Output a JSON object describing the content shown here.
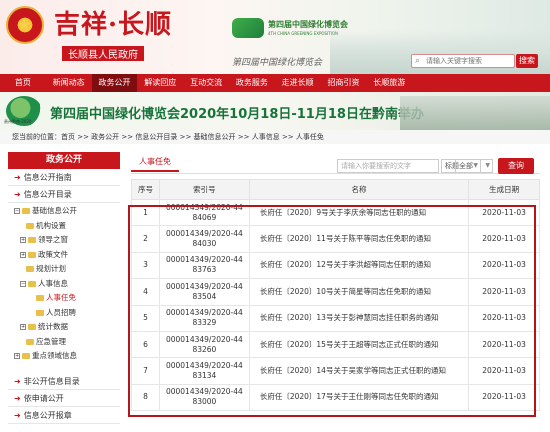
{
  "header": {
    "site_title": "吉祥·长顺",
    "site_subtitle": "长顺县人民政府",
    "expo_title": "第四届中国绿化博览会",
    "expo_subtitle": "4TH CHINA GREENING EXPOSITION",
    "script_text": "第四届中国绿化博览会",
    "search_placeholder": "请输入关键字搜索",
    "search_button": "搜索"
  },
  "nav": [
    "首页",
    "新闻动态",
    "政务公开",
    "解读回应",
    "互动交流",
    "政务服务",
    "走进长顺",
    "招商引资",
    "长顺旅游"
  ],
  "nav_active": 2,
  "banner": {
    "text": "第四届中国绿化博览会2020年10月18日-11月18日在黔南举办",
    "logo_text": "贵州黔南·2020"
  },
  "breadcrumb": "您当前的位置：首页 >> 政务公开 >> 信息公开目录 >> 基础信息公开 >> 人事信息 >> 人事任免",
  "sidebar": {
    "heading": "政务公开",
    "top_items": [
      "信息公开指南",
      "信息公开目录"
    ],
    "tree": [
      {
        "label": "基础信息公开",
        "level": 0,
        "box": "-"
      },
      {
        "label": "机构设置",
        "level": 1,
        "box": ""
      },
      {
        "label": "领导之窗",
        "level": 1,
        "box": "+"
      },
      {
        "label": "政策文件",
        "level": 1,
        "box": "+"
      },
      {
        "label": "规划计划",
        "level": 1,
        "box": ""
      },
      {
        "label": "人事信息",
        "level": 1,
        "box": "-"
      },
      {
        "label": "人事任免",
        "level": 2,
        "box": ""
      },
      {
        "label": "人员招聘",
        "level": 2,
        "box": ""
      },
      {
        "label": "统计数据",
        "level": 1,
        "box": "+"
      },
      {
        "label": "应急管理",
        "level": 1,
        "box": ""
      },
      {
        "label": "重点领域信息",
        "level": 0,
        "box": "+"
      }
    ],
    "bottom_items": [
      "非公开信息目录",
      "依申请公开",
      "信息公开报章"
    ]
  },
  "main": {
    "tab": "人事任免",
    "filter_placeholder": "请输入你要搜索的文字",
    "filter_field": "标题",
    "filter_scope": "全部",
    "query_button": "查询",
    "columns": [
      "序号",
      "索引号",
      "名称",
      "生成日期"
    ],
    "rows": [
      {
        "no": "1",
        "index": "000014349/2020-44 84069",
        "title": "长府任〔2020〕9号关于李庆余等同志任职的通知",
        "date": "2020-11-03"
      },
      {
        "no": "2",
        "index": "000014349/2020-44 84030",
        "title": "长府任〔2020〕11号关于陈平等同志任免职的通知",
        "date": "2020-11-03"
      },
      {
        "no": "3",
        "index": "000014349/2020-44 83763",
        "title": "长府任〔2020〕12号关于李洪超等同志任职的通知",
        "date": "2020-11-03"
      },
      {
        "no": "4",
        "index": "000014349/2020-44 83504",
        "title": "长府任〔2020〕10号关于简星等同志任免职的通知",
        "date": "2020-11-03"
      },
      {
        "no": "5",
        "index": "000014349/2020-44 83329",
        "title": "长府任〔2020〕13号关于彭神慧同志挂任职务的通知",
        "date": "2020-11-03"
      },
      {
        "no": "6",
        "index": "000014349/2020-44 83260",
        "title": "长府任〔2020〕15号关于王超等同志正式任职的通知",
        "date": "2020-11-03"
      },
      {
        "no": "7",
        "index": "000014349/2020-44 83134",
        "title": "长府任〔2020〕14号关于吴家学等同志正式任职的通知",
        "date": "2020-11-03"
      },
      {
        "no": "8",
        "index": "000014349/2020-44 83000",
        "title": "长府任〔2020〕17号关于王仕刚等同志任免职的通知",
        "date": "2020-11-03"
      }
    ]
  },
  "colors": {
    "brand_red": "#c8161d",
    "green": "#17733a"
  }
}
